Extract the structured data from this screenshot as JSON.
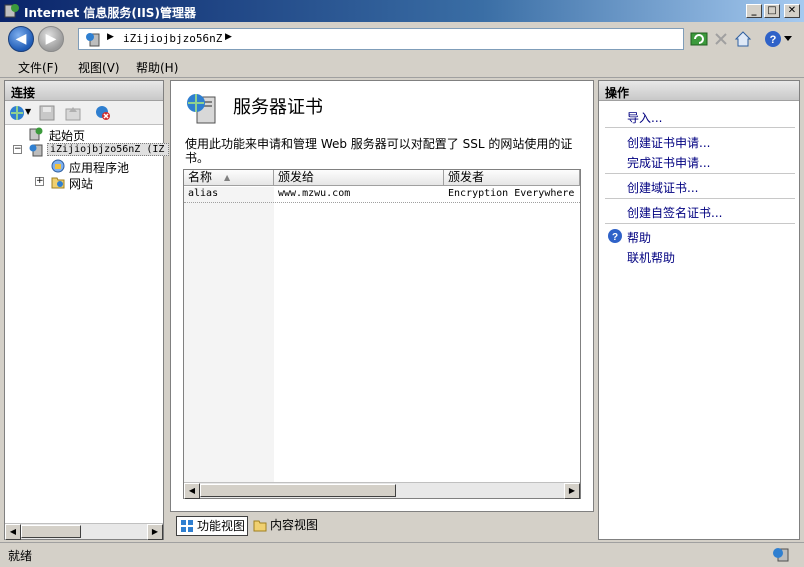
{
  "window": {
    "title": "Internet 信息服务(IIS)管理器",
    "controls": {
      "minimize": "_",
      "maximize": "□",
      "close": "✕"
    }
  },
  "address": {
    "host": "iZijiojbjzo56nZ",
    "separator": "▶"
  },
  "menu": {
    "file": "文件(F)",
    "view": "视图(V)",
    "help": "帮助(H)"
  },
  "connections": {
    "header": "连接",
    "tree": {
      "start_page": "起始页",
      "server": "iZijiojbjzo56nZ (IZ",
      "app_pools": "应用程序池",
      "sites": "网站"
    }
  },
  "main": {
    "title": "服务器证书",
    "description": "使用此功能来申请和管理 Web 服务器可以对配置了 SSL 的网站使用的证书。",
    "table": {
      "columns": [
        "名称",
        "颁发给",
        "颁发者"
      ],
      "rows": [
        [
          "alias",
          "www.mzwu.com",
          "Encryption Everywhere"
        ]
      ]
    }
  },
  "view_tabs": {
    "features": "功能视图",
    "content": "内容视图"
  },
  "actions": {
    "header": "操作",
    "import": "导入...",
    "create_request": "创建证书申请...",
    "complete_request": "完成证书申请...",
    "create_domain_cert": "创建域证书...",
    "create_self_signed": "创建自签名证书...",
    "help": "帮助",
    "online_help": "联机帮助"
  },
  "status": {
    "text": "就绪"
  },
  "colors": {
    "accent": "#0a246a",
    "link": "#000080"
  }
}
